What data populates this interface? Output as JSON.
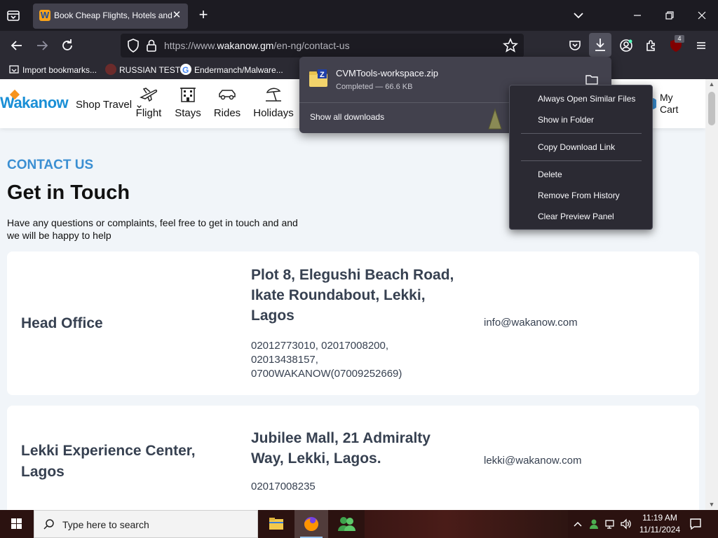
{
  "browser": {
    "tab": {
      "title": "Book Cheap Flights, Hotels and",
      "close": "✕"
    },
    "new_tab": "+",
    "url_prefix": "https://www.",
    "url_domain": "wakanow.gm",
    "url_path": "/en-ng/contact-us",
    "extension_badge": "4",
    "bookmarks": [
      {
        "label": "Import bookmarks..."
      },
      {
        "label": "RUSSIAN TEST"
      },
      {
        "label": "Endermanch/Malware..."
      }
    ]
  },
  "downloads_panel": {
    "file_name": "CVMTools-workspace.zip",
    "status": "Completed — 66.6 KB",
    "show_all": "Show all downloads"
  },
  "context_menu": {
    "items": [
      "Always Open Similar Files",
      "Show in Folder",
      "Copy Download Link",
      "Delete",
      "Remove From History",
      "Clear Preview Panel"
    ]
  },
  "site": {
    "logo": "Wakanow",
    "shop_travel": "Shop Travel",
    "services": [
      "Flight",
      "Stays",
      "Rides",
      "Holidays"
    ],
    "cart": "My Cart"
  },
  "contact": {
    "eyebrow": "CONTACT US",
    "title": "Get in Touch",
    "subtitle": "Have any questions or complaints, feel free to get in touch and and we will be happy to help",
    "offices": [
      {
        "name": "Head Office",
        "address": "Plot 8, Elegushi Beach Road, Ikate Roundabout, Lekki, Lagos",
        "phones": "02012773010, 02017008200, 02013438157, 0700WAKANOW(07009252669)",
        "email": "info@wakanow.com"
      },
      {
        "name": "Lekki Experience Center, Lagos",
        "address": "Jubilee Mall, 21 Admiralty Way, Lekki, Lagos.",
        "phones": "02017008235",
        "email": "lekki@wakanow.com"
      }
    ]
  },
  "taskbar": {
    "search_placeholder": "Type here to search",
    "time": "11:19 AM",
    "date": "11/11/2024"
  },
  "colors": {
    "accent_blue": "#3b8fd2",
    "browser_dark": "#1c1b22",
    "browser_toolbar": "#2b2a33",
    "panel": "#42414d"
  }
}
